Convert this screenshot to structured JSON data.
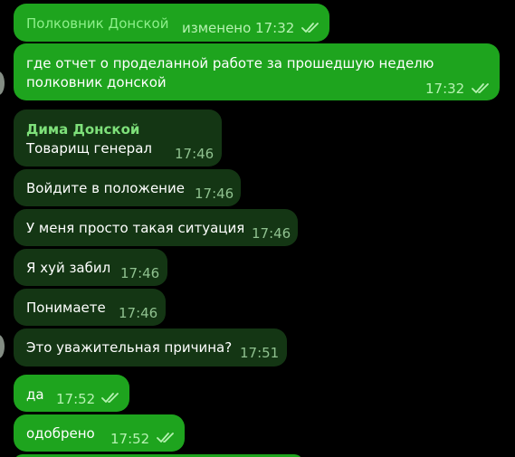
{
  "colors": {
    "background": "#000000",
    "outgoing_bubble": "#1ea41e",
    "incoming_bubble": "#143614",
    "read_checks": "#b6f2b2"
  },
  "messages": [
    {
      "direction": "out",
      "text": "Полковник Донской",
      "time": "изменено 17:32",
      "status_icon": "double-check-icon"
    },
    {
      "direction": "out",
      "text_line1": "где отчет о проделанной работе за прошедшую неделю",
      "text_line2": "полковник донской",
      "time": "17:32",
      "status_icon": "double-check-icon"
    },
    {
      "direction": "in",
      "sender": "Дима Донской",
      "text": "Товарищ генерал",
      "time": "17:46"
    },
    {
      "direction": "in",
      "text": "Войдите в положение",
      "time": "17:46"
    },
    {
      "direction": "in",
      "text": "У меня просто такая ситуация",
      "time": "17:46"
    },
    {
      "direction": "in",
      "text": "Я хуй забил",
      "time": "17:46"
    },
    {
      "direction": "in",
      "text": "Понимаете",
      "time": "17:46"
    },
    {
      "direction": "in",
      "text": "Это уважительная причина?",
      "time": "17:51"
    },
    {
      "direction": "out",
      "text": "да",
      "time": "17:52",
      "status_icon": "double-check-icon"
    },
    {
      "direction": "out",
      "text": "одобрено",
      "time": "17:52",
      "status_icon": "double-check-icon"
    }
  ]
}
